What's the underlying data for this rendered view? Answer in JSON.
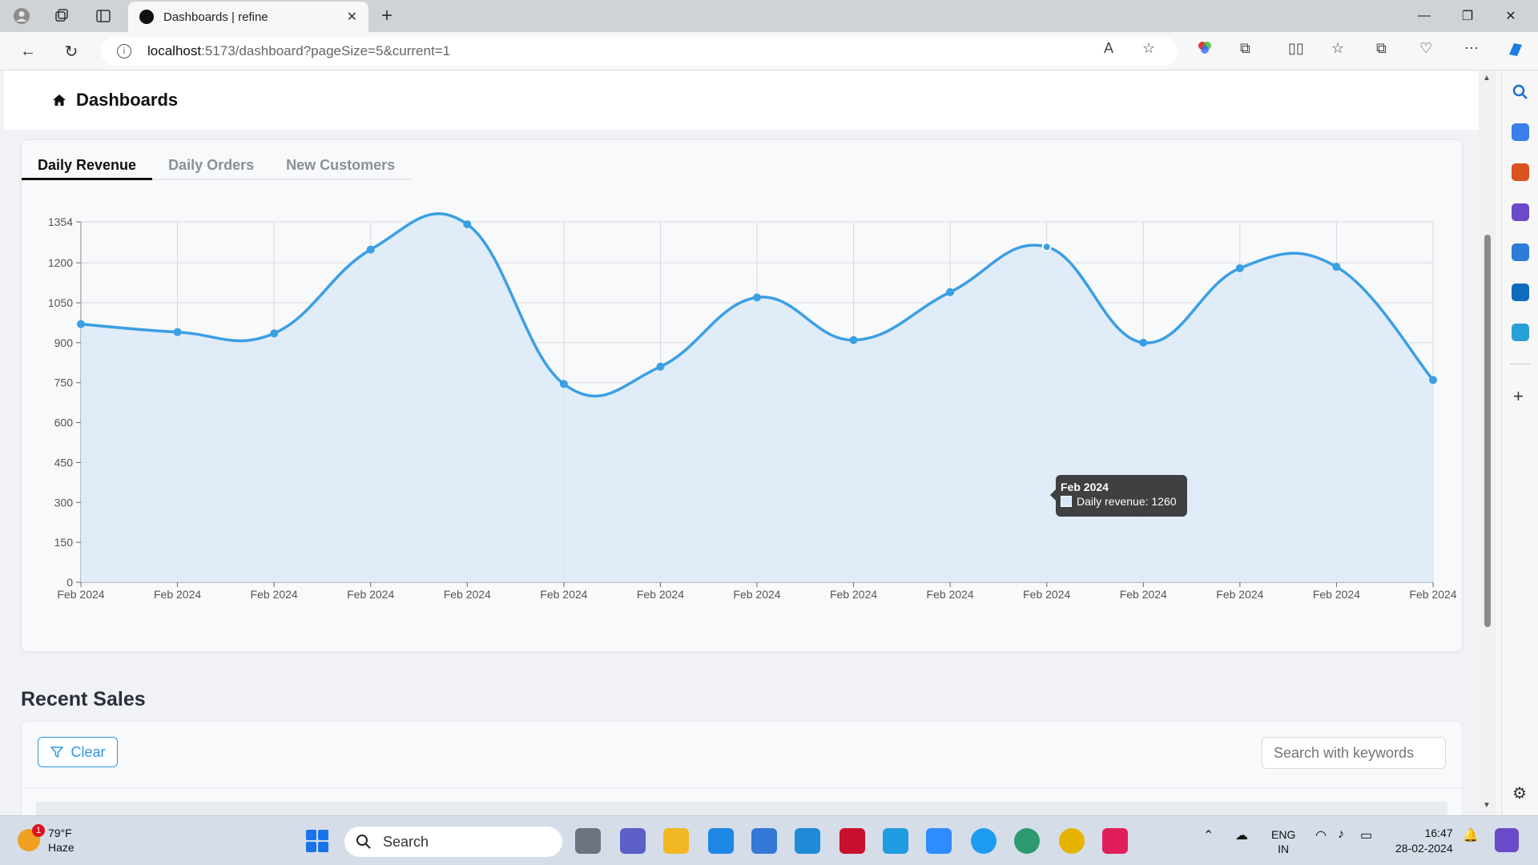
{
  "browser": {
    "tab_title": "Dashboards | refine",
    "url_host": "localhost",
    "url_rest": ":5173/dashboard?pageSize=5&current=1"
  },
  "header": {
    "title": "Dashboards"
  },
  "chart_tabs": [
    {
      "label": "Daily Revenue",
      "active": true
    },
    {
      "label": "Daily Orders",
      "active": false
    },
    {
      "label": "New Customers",
      "active": false
    }
  ],
  "chart_data": {
    "type": "area",
    "categories": [
      "Feb 2024",
      "Feb 2024",
      "Feb 2024",
      "Feb 2024",
      "Feb 2024",
      "Feb 2024",
      "Feb 2024",
      "Feb 2024",
      "Feb 2024",
      "Feb 2024",
      "Feb 2024",
      "Feb 2024",
      "Feb 2024",
      "Feb 2024",
      "Feb 2024"
    ],
    "series": [
      {
        "name": "Daily revenue",
        "values": [
          970,
          940,
          935,
          1250,
          1345,
          745,
          810,
          1070,
          910,
          1090,
          1260,
          900,
          1180,
          1185,
          760
        ]
      }
    ],
    "ylim": [
      0,
      1354
    ],
    "yticks": [
      0,
      150,
      300,
      450,
      600,
      750,
      900,
      1050,
      1200,
      1354
    ],
    "grid": true,
    "line_color": "#3b9fe3",
    "fill_color": "#dceaf7"
  },
  "tooltip": {
    "title": "Feb 2024",
    "label": "Daily revenue: 1260"
  },
  "recent_sales": {
    "title": "Recent Sales",
    "clear_label": "Clear",
    "search_placeholder": "Search with keywords"
  },
  "taskbar": {
    "weather_temp": "79°F",
    "weather_desc": "Haze",
    "weather_badge": "1",
    "search_label": "Search",
    "lang_top": "ENG",
    "lang_bottom": "IN",
    "time": "16:47",
    "date": "28-02-2024"
  }
}
